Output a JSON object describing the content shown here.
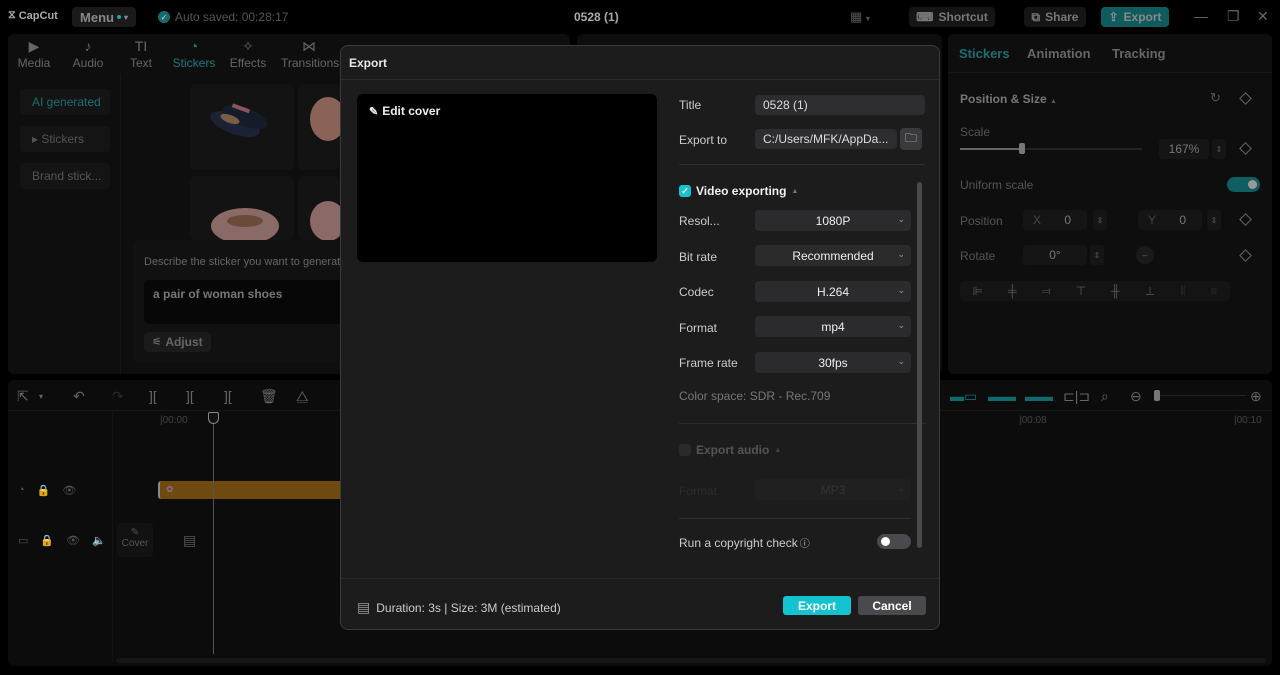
{
  "titlebar": {
    "app_name": "CapCut",
    "menu_label": "Menu",
    "autosave_text": "Auto saved: 00:28:17",
    "project_title": "0528 (1)",
    "shortcut_label": "Shortcut",
    "share_label": "Share",
    "export_label": "Export",
    "minimize_glyph": "—",
    "maximize_glyph": "❐",
    "close_glyph": "✕"
  },
  "left_panel": {
    "tabs": [
      {
        "label": "Media",
        "icon": "media-icon",
        "glyph": "▶"
      },
      {
        "label": "Audio",
        "icon": "audio-icon",
        "glyph": "♪"
      },
      {
        "label": "Text",
        "icon": "text-icon",
        "glyph": "TI"
      },
      {
        "label": "Stickers",
        "icon": "stickers-icon",
        "glyph": "◔"
      },
      {
        "label": "Effects",
        "icon": "effects-icon",
        "glyph": "✧"
      },
      {
        "label": "Transitions",
        "icon": "transitions-icon",
        "glyph": "⋈"
      }
    ],
    "active_tab": "Stickers",
    "side_items": [
      {
        "label": "AI generated",
        "active": true
      },
      {
        "label": "▸ Stickers",
        "active": false
      },
      {
        "label": "Brand stick...",
        "active": false
      }
    ],
    "prompt_label": "Describe the sticker you want to generat",
    "prompt_value": "a pair of woman shoes",
    "adjust_label": "Adjust"
  },
  "right_panel": {
    "tabs": [
      "Stickers",
      "Animation",
      "Tracking"
    ],
    "active_tab": "Stickers",
    "section_title": "Position & Size",
    "scale_label": "Scale",
    "scale_value": "167%",
    "scale_slider_fraction": 0.34,
    "uniform_scale_label": "Uniform scale",
    "uniform_scale_on": true,
    "position_label": "Position",
    "pos_x_label": "X",
    "pos_x": "0",
    "pos_y_label": "Y",
    "pos_y": "0",
    "rotate_label": "Rotate",
    "rotate_value": "0°"
  },
  "timeline": {
    "time_marks": [
      "00:00",
      "00:08",
      "00:10"
    ],
    "cover_label": "Cover"
  },
  "export_dialog": {
    "title": "Export",
    "edit_cover_label": "Edit cover",
    "title_label": "Title",
    "title_value": "0528 (1)",
    "export_to_label": "Export to",
    "export_to_value": "C:/Users/MFK/AppDa...",
    "video_section_label": "Video exporting",
    "video_enabled": true,
    "fields": [
      {
        "label": "Resol...",
        "value": "1080P"
      },
      {
        "label": "Bit rate",
        "value": "Recommended"
      },
      {
        "label": "Codec",
        "value": "H.264"
      },
      {
        "label": "Format",
        "value": "mp4"
      },
      {
        "label": "Frame rate",
        "value": "30fps"
      }
    ],
    "color_space": "Color space: SDR - Rec.709",
    "audio_section_label": "Export audio",
    "audio_enabled": false,
    "audio_format_label": "Format",
    "audio_format_value": "MP3",
    "copyright_label": "Run a copyright check",
    "copyright_on": false,
    "footer_info": "Duration: 3s | Size: 3M (estimated)",
    "export_button": "Export",
    "cancel_button": "Cancel"
  },
  "colors": {
    "accent": "#14c3d0",
    "accent_dim": "#1a6e72",
    "clip_sticker": "#6e4a10"
  }
}
